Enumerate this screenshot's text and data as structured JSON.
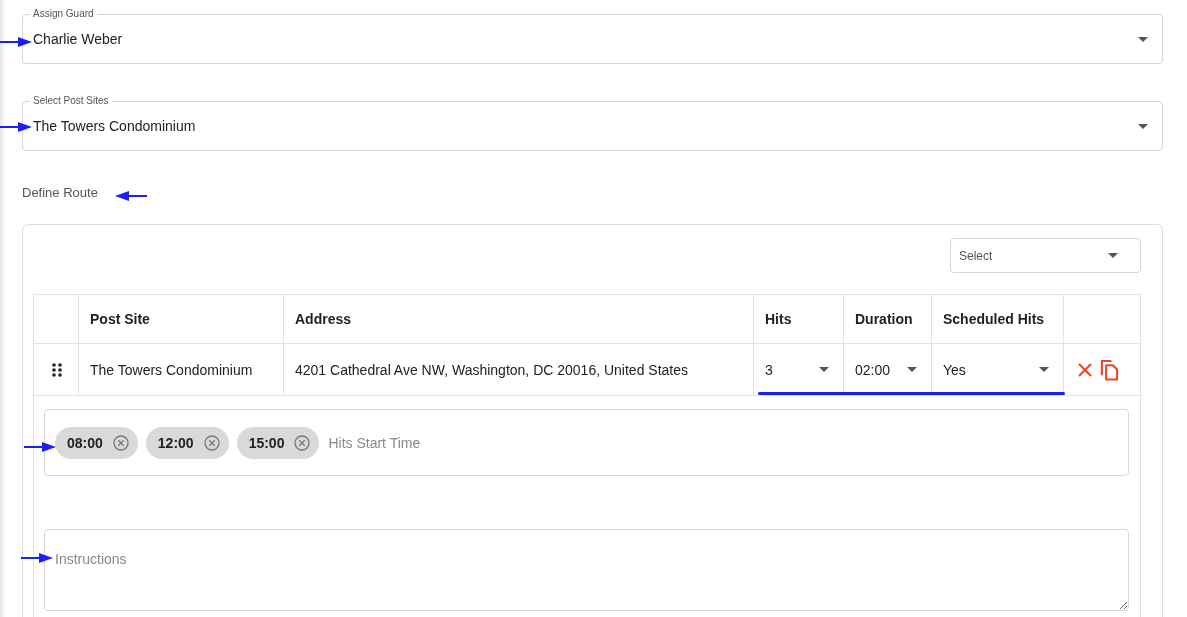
{
  "guard_field": {
    "label": "Assign Guard",
    "value": "Charlie Weber"
  },
  "post_sites_field": {
    "label": "Select Post Sites",
    "value": "The Towers Condominium"
  },
  "section_title": "Define Route",
  "route_card": {
    "select": {
      "placeholder": "Select"
    },
    "table": {
      "columns": [
        "Post Site",
        "Address",
        "Hits",
        "Duration",
        "Scheduled Hits"
      ],
      "rows": [
        {
          "post_site": "The Towers Condominium",
          "address": "4201 Cathedral Ave NW, Washington, DC 20016, United States",
          "hits": "3",
          "duration": "02:00",
          "scheduled_hits": "Yes",
          "start_times": [
            "08:00",
            "12:00",
            "15:00"
          ],
          "start_times_placeholder": "Hits Start Time",
          "instructions_placeholder": "Instructions"
        }
      ]
    }
  }
}
